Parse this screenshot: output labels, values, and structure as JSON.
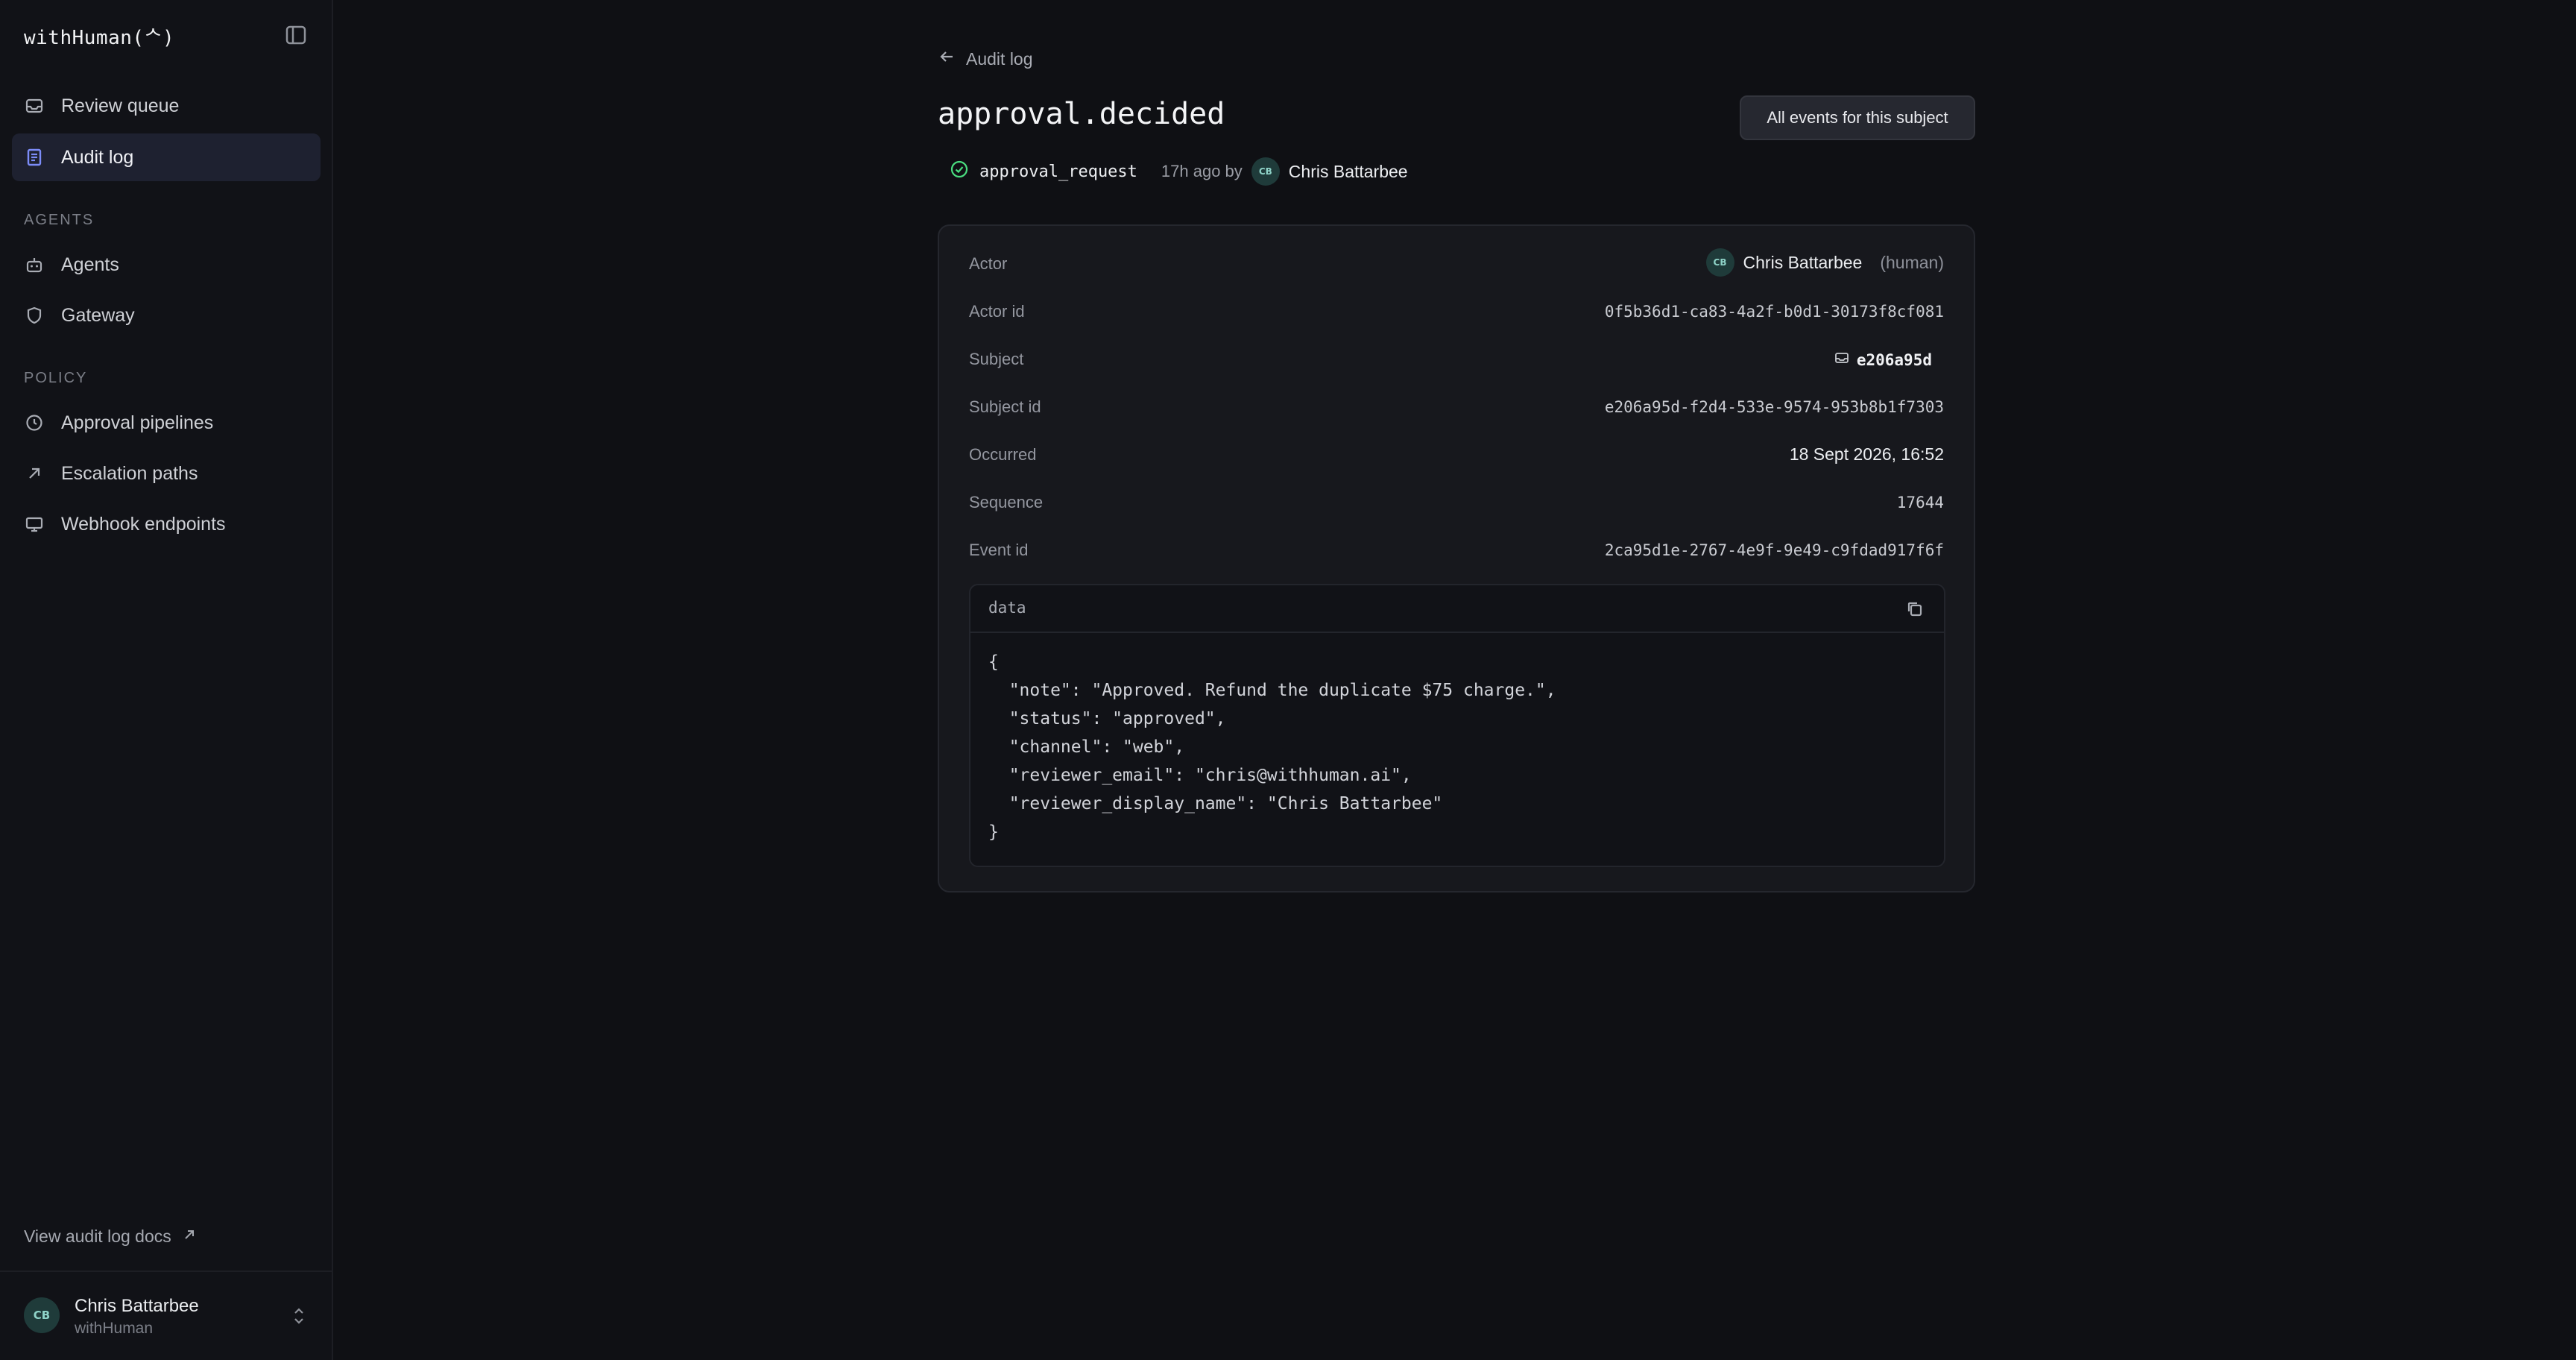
{
  "app": {
    "brand": "withHuman(ᄉ)"
  },
  "sidebar": {
    "nav": [
      {
        "label": "Review queue",
        "icon": "inbox-icon"
      },
      {
        "label": "Audit log",
        "icon": "document-icon",
        "active": true
      }
    ],
    "sections": [
      {
        "label": "AGENTS",
        "items": [
          {
            "label": "Agents",
            "icon": "robot-icon"
          },
          {
            "label": "Gateway",
            "icon": "shield-icon"
          }
        ]
      },
      {
        "label": "POLICY",
        "items": [
          {
            "label": "Approval pipelines",
            "icon": "clock-icon"
          },
          {
            "label": "Escalation paths",
            "icon": "arrow-up-right-icon"
          },
          {
            "label": "Webhook endpoints",
            "icon": "monitor-icon"
          }
        ]
      }
    ],
    "docs_link": "View audit log docs",
    "user": {
      "initials": "CB",
      "name": "Chris Battarbee",
      "org": "withHuman"
    }
  },
  "header": {
    "back_label": "Audit log",
    "title": "approval.decided",
    "all_events_button": "All events for this subject",
    "meta": {
      "kind": "approval_request",
      "ago": "17h ago by",
      "actor_initials": "CB",
      "actor_name": "Chris Battarbee"
    }
  },
  "details": {
    "actor": {
      "label": "Actor",
      "initials": "CB",
      "name": "Chris Battarbee",
      "kind": "(human)"
    },
    "actor_id": {
      "label": "Actor id",
      "value": "0f5b36d1-ca83-4a2f-b0d1-30173f8cf081"
    },
    "subject": {
      "label": "Subject",
      "value": "e206a95d"
    },
    "subject_id": {
      "label": "Subject id",
      "value": "e206a95d-f2d4-533e-9574-953b8b1f7303"
    },
    "occurred": {
      "label": "Occurred",
      "value": "18 Sept 2026, 16:52"
    },
    "sequence": {
      "label": "Sequence",
      "value": "17644"
    },
    "event_id": {
      "label": "Event id",
      "value": "2ca95d1e-2767-4e9f-9e49-c9fdad917f6f"
    }
  },
  "data_panel": {
    "title": "data",
    "lines": [
      "{",
      "  \"note\": \"Approved. Refund the duplicate $75 charge.\",",
      "  \"status\": \"approved\",",
      "  \"channel\": \"web\",",
      "  \"reviewer_email\": \"chris@withhuman.ai\",",
      "  \"reviewer_display_name\": \"Chris Battarbee\"",
      "}"
    ]
  },
  "colors": {
    "accent": "#7c8cf8",
    "success": "#4ade80",
    "avatar_bg": "#1f3b3a"
  }
}
